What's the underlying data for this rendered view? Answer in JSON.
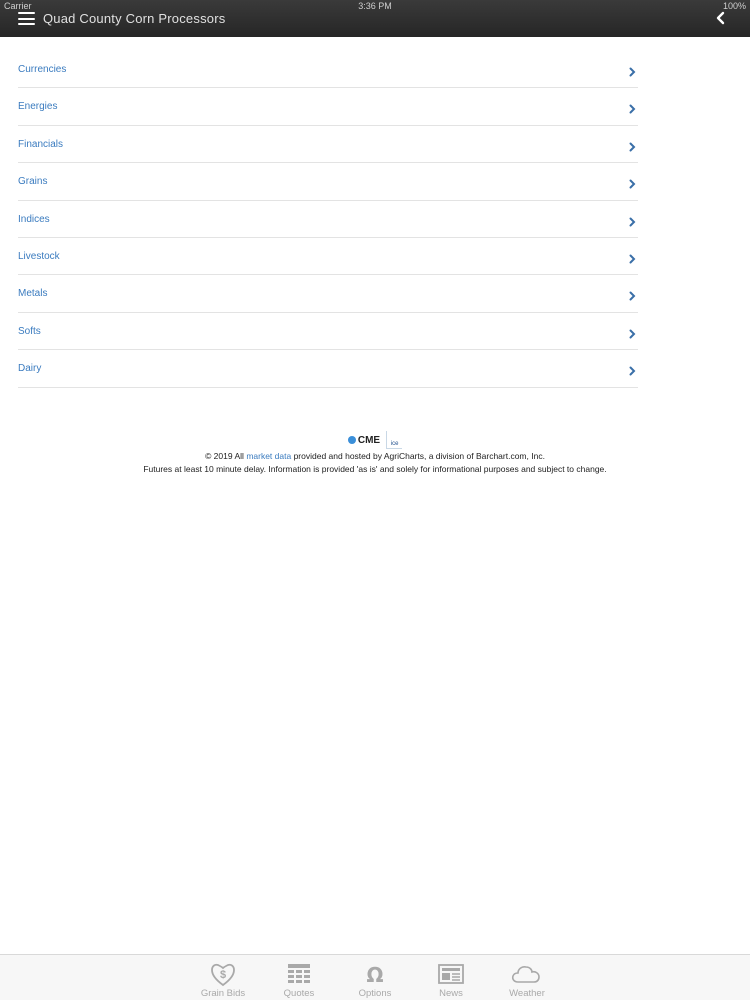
{
  "status_bar": {
    "carrier": "Carrier",
    "time": "3:36 PM",
    "battery": "100%"
  },
  "header": {
    "title": "Quad County Corn Processors"
  },
  "categories": [
    {
      "label": "Currencies"
    },
    {
      "label": "Energies"
    },
    {
      "label": "Financials"
    },
    {
      "label": "Grains"
    },
    {
      "label": "Indices"
    },
    {
      "label": "Livestock"
    },
    {
      "label": "Metals"
    },
    {
      "label": "Softs"
    },
    {
      "label": "Dairy"
    }
  ],
  "footer": {
    "cme_logo": "CME",
    "ice_logo": "ice",
    "copyright_prefix": "© 2019 All",
    "market_data_link": "market data",
    "copyright_suffix": "provided and hosted by AgriCharts, a division of Barchart.com, Inc.",
    "disclaimer": "Futures at least 10 minute delay. Information is provided 'as is' and solely for informational purposes and subject to change."
  },
  "tabs": [
    {
      "label": "Grain Bids",
      "icon": "grain-bids-icon"
    },
    {
      "label": "Quotes",
      "icon": "quotes-icon"
    },
    {
      "label": "Options",
      "icon": "omega-icon"
    },
    {
      "label": "News",
      "icon": "newspaper-icon"
    },
    {
      "label": "Weather",
      "icon": "cloud-icon"
    }
  ],
  "colors": {
    "link": "#3a7bbf",
    "header_bg": "#2e2e2e",
    "tab_inactive": "#a9a9a9"
  }
}
